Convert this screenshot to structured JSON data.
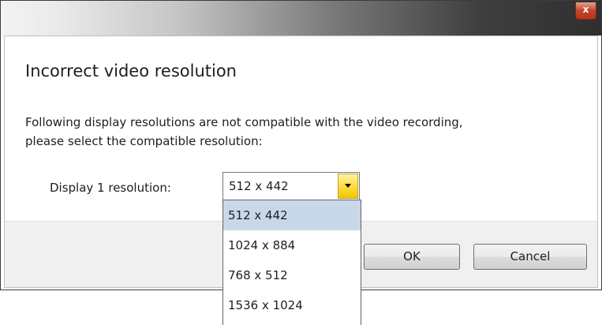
{
  "window": {
    "close_glyph": "x"
  },
  "dialog": {
    "title": "Incorrect video resolution",
    "message_line1": "Following display resolutions are not compatible with the video recording,",
    "message_line2": "please select the compatible resolution:"
  },
  "resolution": {
    "label": "Display 1 resolution:",
    "selected": "512 x 442",
    "options": [
      "512 x 442",
      "1024 x 884",
      "768 x 512",
      "1536 x 1024"
    ],
    "highlighted_index": 0
  },
  "buttons": {
    "ok_label": "OK",
    "cancel_label": "Cancel"
  },
  "colors": {
    "close_button": "#c4452b",
    "combo_arrow": "#ffdd3c",
    "option_highlight": "#c9d8e9"
  },
  "icons": {
    "close": "close-icon",
    "dropdown": "chevron-down-icon"
  }
}
